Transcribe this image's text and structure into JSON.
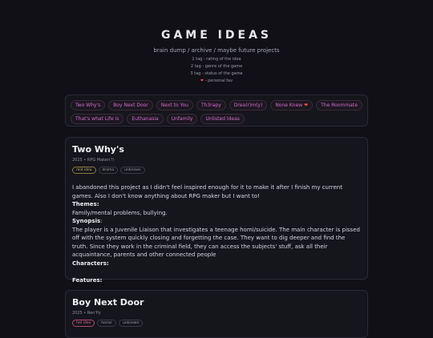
{
  "header": {
    "title": "GAME IDEAS",
    "subtitle": "brain dump / archive / maybe future projects",
    "legend": [
      "1 tag - rating of the idea",
      "2 tag - genre of the game",
      "3 tag - status of the game"
    ],
    "legend_fav": "- personal fav"
  },
  "tags": [
    "Two Why's",
    "Boy Next Door",
    "Next to You",
    "Th3rapy",
    "Drea(r)m(y)",
    "None Knew",
    "The Roommate",
    "That's what Life is",
    "Euthanasia",
    "Unfamily",
    "Unlisted Ideas"
  ],
  "cards": [
    {
      "title": "Two Why's",
      "meta": "2025 • RPG Maker(?)",
      "badges": [
        "mid idea",
        "drama",
        "unknown"
      ],
      "intro": "I abandoned this project as I didn't feel inspired enough for it to make it after I finish my current games. Also I don't know anything about RPG maker but I want to!",
      "themes_label": "Themes:",
      "themes": "Family/mental problems, bullying.",
      "synopsis_label": "Synopsis",
      "synopsis": "The player is a Juvenile Liaison that investigates a teenage homi/suicide. The main character is pissed off with the system quickly closing and forgetting the case. They want to dig deeper and find the truth. Since they work in the criminal field, they can access the subjects' stuff, ask all their acquaintance, parents and other connected people",
      "characters_label": "Characters:",
      "features_label": "Features:"
    },
    {
      "title": "Boy Next Door",
      "meta": "2025 • Ren'Py",
      "badges": [
        "fed idea",
        "horror",
        "unknown"
      ]
    }
  ],
  "colors": {
    "accent": "#d56ccf",
    "heart": "#e0504c",
    "background": "#101016"
  }
}
